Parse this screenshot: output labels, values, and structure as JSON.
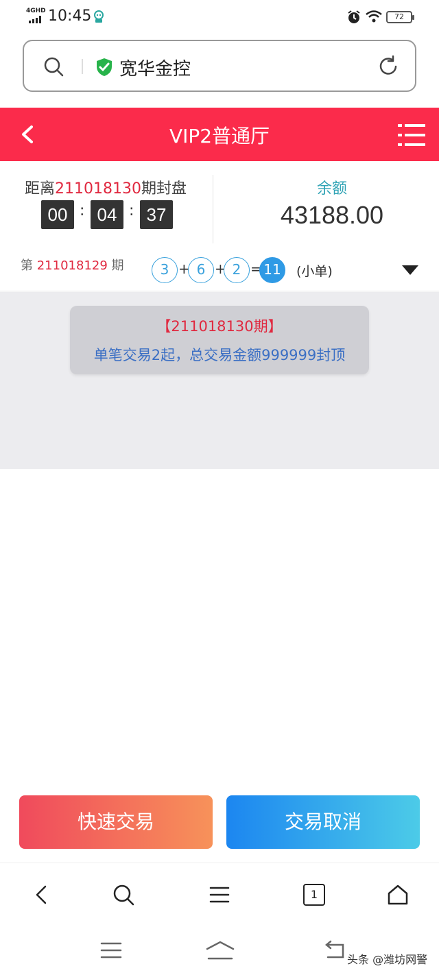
{
  "status_bar": {
    "network": "4GHD",
    "time": "10:45",
    "battery": "72"
  },
  "address_bar": {
    "site_name": "宽华金控"
  },
  "header": {
    "title": "VIP2普通厅"
  },
  "countdown": {
    "prefix": "距离",
    "period": "211018130",
    "suffix": "期封盘",
    "hours": "00",
    "minutes": "04",
    "seconds": "37",
    "separator": ":"
  },
  "balance": {
    "label": "余额",
    "value": "43188.00"
  },
  "last_draw": {
    "prefix": "第",
    "period": "211018129",
    "suffix": "期",
    "numbers": [
      "3",
      "6",
      "2"
    ],
    "plus": "+",
    "equals": "=",
    "sum": "11",
    "result": "(小单)"
  },
  "notice": {
    "title": "【211018130期】",
    "body": "单笔交易2起，总交易金额999999封顶"
  },
  "actions": {
    "quick_trade": "快速交易",
    "cancel_trade": "交易取消"
  },
  "browser_toolbar": {
    "tabs_count": "1"
  },
  "watermark": "头条 @潍坊网警",
  "colors": {
    "header": "#fb2b4b",
    "accent_red": "#e0283f",
    "ball_blue": "#2f9ae5",
    "balance_label": "#2fa3b5"
  }
}
